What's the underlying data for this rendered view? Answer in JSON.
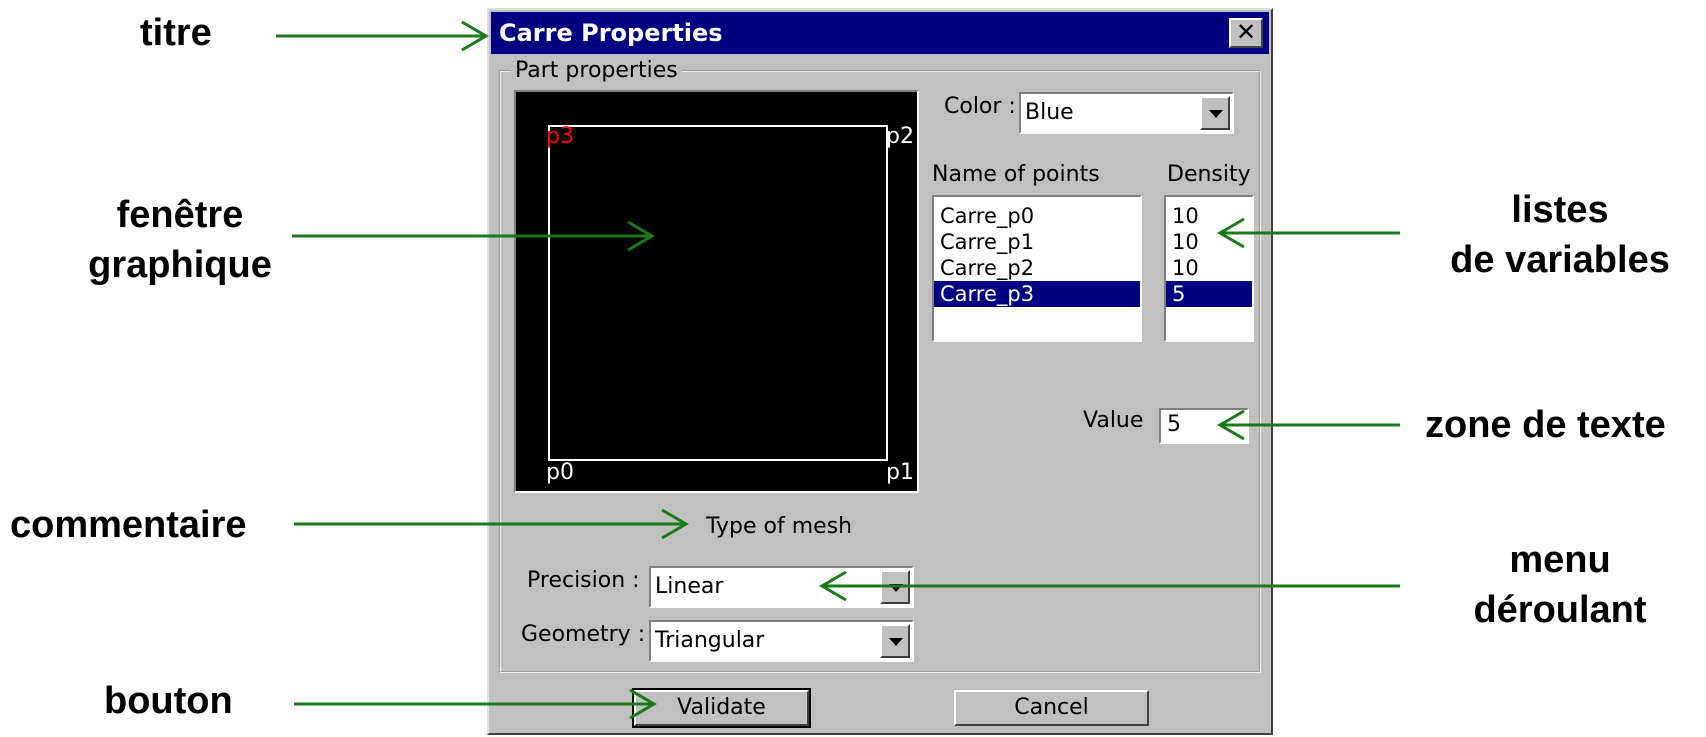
{
  "annotations": {
    "titre": "titre",
    "fenetre": [
      "fenêtre",
      "graphique"
    ],
    "commentaire": "commentaire",
    "bouton": "bouton",
    "listes": [
      "listes",
      "de variables"
    ],
    "zone_texte": "zone de texte",
    "menu": [
      "menu",
      "déroulant"
    ],
    "arrow_color": "#1a7a1a"
  },
  "dialog": {
    "title": "Carre Properties",
    "close_glyph": "✕",
    "group_label": "Part properties",
    "canvas": {
      "points": {
        "p0": "p0",
        "p1": "p1",
        "p2": "p2",
        "p3": "p3"
      },
      "highlight_color": "#ff0000"
    },
    "color_label": "Color :",
    "color_value": "Blue",
    "names_header": "Name of points",
    "density_header": "Density",
    "names": [
      "Carre_p0",
      "Carre_p1",
      "Carre_p2",
      "Carre_p3"
    ],
    "densities": [
      "10",
      "10",
      "10",
      "5"
    ],
    "selected_index": 3,
    "value_label": "Value",
    "value": "5",
    "mesh_label": "Type of mesh",
    "precision_label": "Precision :",
    "precision_value": "Linear",
    "geometry_label": "Geometry :",
    "geometry_value": "Triangular",
    "validate_label": "Validate",
    "cancel_label": "Cancel",
    "title_bar_color": "#000080",
    "face_color": "#c0c0c0"
  }
}
